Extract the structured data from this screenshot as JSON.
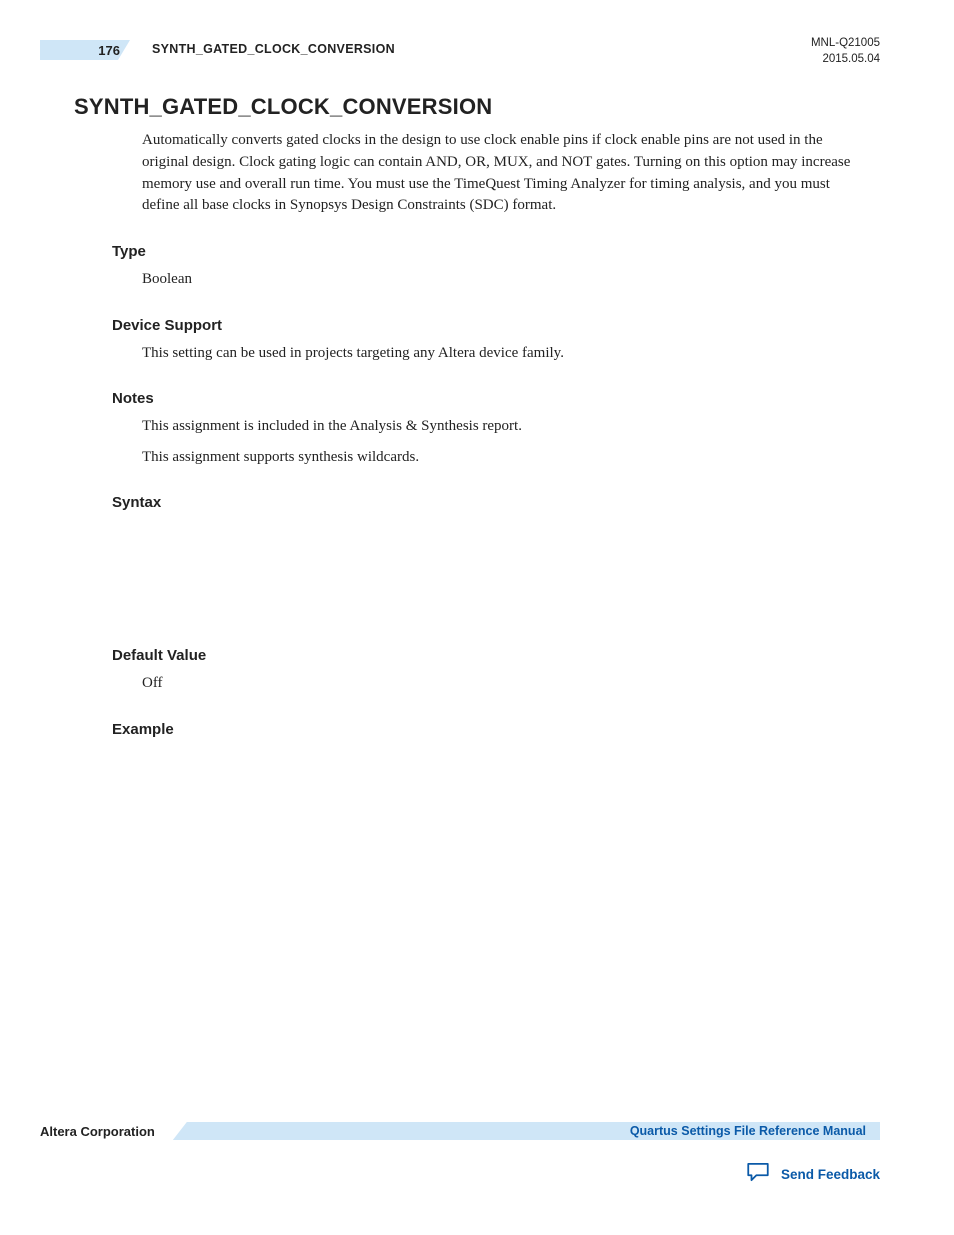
{
  "header": {
    "page_number": "176",
    "running_title": "SYNTH_GATED_CLOCK_CONVERSION",
    "doc_id": "MNL-Q21005",
    "date": "2015.05.04"
  },
  "title": "SYNTH_GATED_CLOCK_CONVERSION",
  "intro": "Automatically converts gated clocks in the design to use clock enable pins if clock enable pins are not used in the original design. Clock gating logic can contain AND, OR, MUX, and NOT gates. Turning on this option may increase memory use and overall run time. You must use the TimeQuest Timing Analyzer for timing analysis, and you must define all base clocks in Synopsys Design Constraints (SDC) format.",
  "sections": {
    "type": {
      "heading": "Type",
      "body": "Boolean"
    },
    "device_support": {
      "heading": "Device Support",
      "body": "This setting can be used in projects targeting any Altera device family."
    },
    "notes": {
      "heading": "Notes",
      "body1": "This assignment is included in the Analysis & Synthesis report.",
      "body2": "This assignment supports synthesis wildcards."
    },
    "syntax": {
      "heading": "Syntax"
    },
    "default_value": {
      "heading": "Default Value",
      "body": "Off"
    },
    "example": {
      "heading": "Example"
    }
  },
  "footer": {
    "company": "Altera Corporation",
    "manual_link": "Quartus Settings File Reference Manual",
    "feedback_link": "Send Feedback"
  }
}
